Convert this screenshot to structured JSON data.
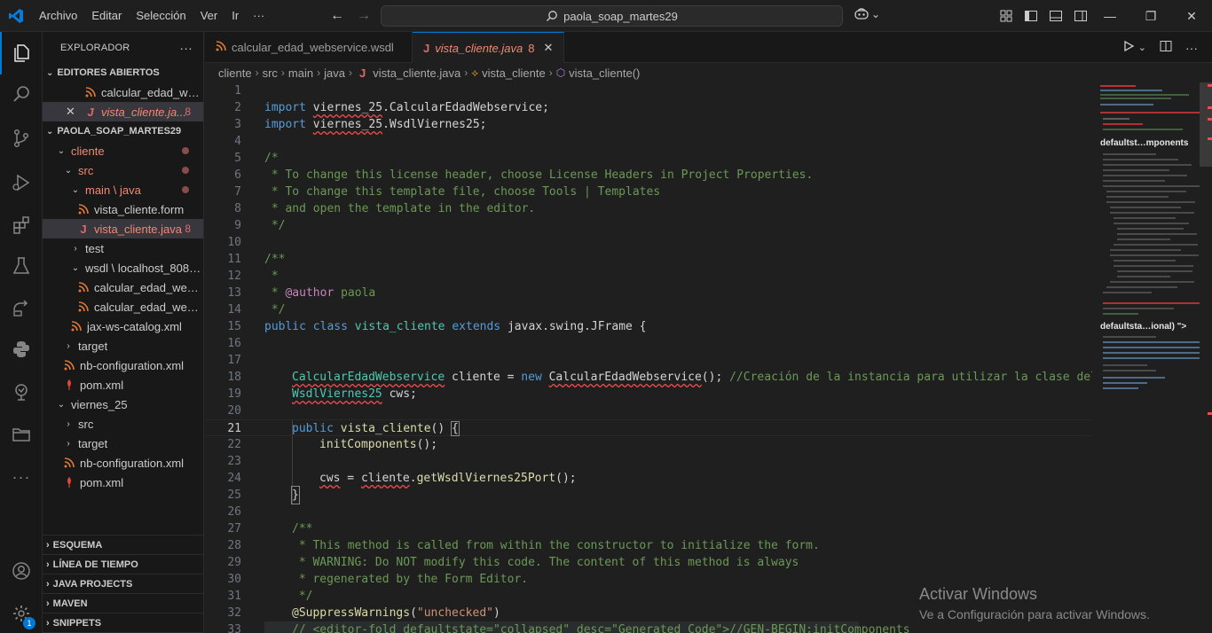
{
  "titlebar": {
    "menu": [
      "Archivo",
      "Editar",
      "Selección",
      "Ver",
      "Ir",
      "···"
    ],
    "search_text": "paola_soap_martes29"
  },
  "explorer": {
    "title": "EXPLORADOR",
    "more": "···",
    "open_editors_title": "EDITORES ABIERTOS",
    "open_editors": [
      {
        "label": "calcular_edad_web...",
        "count": ""
      },
      {
        "label": "vista_cliente.ja...",
        "count": "8"
      }
    ],
    "project_title": "PAOLA_SOAP_MARTES29",
    "tree": [
      {
        "label": "cliente",
        "count": ""
      },
      {
        "label": "src",
        "count": ""
      },
      {
        "label": "main \\ java",
        "count": ""
      },
      {
        "label": "vista_cliente.form",
        "count": ""
      },
      {
        "label": "vista_cliente.java",
        "count": "8"
      },
      {
        "label": "test",
        "count": ""
      },
      {
        "label": "wsdl \\ localhost_8080...",
        "count": ""
      },
      {
        "label": "calcular_edad_webs...",
        "count": ""
      },
      {
        "label": "calcular_edad_webs...",
        "count": ""
      },
      {
        "label": "jax-ws-catalog.xml",
        "count": ""
      },
      {
        "label": "target",
        "count": ""
      },
      {
        "label": "nb-configuration.xml",
        "count": ""
      },
      {
        "label": "pom.xml",
        "count": ""
      },
      {
        "label": "viernes_25",
        "count": ""
      },
      {
        "label": "src",
        "count": ""
      },
      {
        "label": "target",
        "count": ""
      },
      {
        "label": "nb-configuration.xml",
        "count": ""
      },
      {
        "label": "pom.xml",
        "count": ""
      }
    ],
    "bottom_sections": [
      "ESQUEMA",
      "LÍNEA DE TIEMPO",
      "JAVA PROJECTS",
      "MAVEN",
      "SNIPPETS"
    ]
  },
  "activity": {
    "badge": "1"
  },
  "tabs": [
    {
      "label": "calcular_edad_webservice.wsdl",
      "count": ""
    },
    {
      "label": "vista_cliente.java",
      "count": "8"
    }
  ],
  "breadcrumb": [
    "cliente",
    "src",
    "main",
    "java",
    "vista_cliente.java",
    "vista_cliente",
    "vista_cliente()"
  ],
  "editor": {
    "line_numbers": [
      "1",
      "2",
      "3",
      "4",
      "5",
      "6",
      "7",
      "8",
      "9",
      "10",
      "11",
      "12",
      "13",
      "14",
      "15",
      "16",
      "17",
      "18",
      "19",
      "20",
      "21",
      "22",
      "23",
      "24",
      "25",
      "26",
      "27",
      "28",
      "29",
      "30",
      "31",
      "32",
      "33"
    ],
    "current_line": "21",
    "code": {
      "l2_kw": "import",
      "l2_pkg": "viernes_25",
      "l2_rest": ".CalcularEdadWebservice;",
      "l3_kw": "import",
      "l3_pkg": "viernes_25",
      "l3_rest": ".WsdlViernes25;",
      "l5": "/*",
      "l6": " * To change this license header, choose License Headers in Project Properties.",
      "l7": " * To change this template file, choose Tools | Templates",
      "l8": " * and open the template in the editor.",
      "l9": " */",
      "l11": "/**",
      "l12": " *",
      "l13_pre": " * ",
      "l13_tag": "@author",
      "l13_rest": " paola",
      "l14": " */",
      "l15_kw1": "public",
      "l15_kw2": "class",
      "l15_name": "vista_cliente",
      "l15_kw3": "extends",
      "l15_rest": "javax.swing.JFrame {",
      "l18_type": "CalcularEdadWebservice",
      "l18_var": "cliente",
      "l18_eq": " = ",
      "l18_new": "new",
      "l18_ctor": "CalcularEdadWebservice",
      "l18_paren": "();",
      "l18_cm": " //Creación de la instancia para utilizar la clase del servicio",
      "l19_type": "WsdlViernes25",
      "l19_var": "cws;",
      "l21_kw": "public",
      "l21_name": "vista_cliente",
      "l21_paren": "() ",
      "l21_brace": "{",
      "l22_fn": "initComponents",
      "l22_rest": "();",
      "l24_var": "cws",
      "l24_eq": " = ",
      "l24_obj": "cliente",
      "l24_dot": ".",
      "l24_fn": "getWsdlViernes25Port",
      "l24_rest": "();",
      "l25": "}",
      "l27": "/**",
      "l28": " * This method is called from within the constructor to initialize the form.",
      "l29": " * WARNING: Do NOT modify this code. The content of this method is always",
      "l30": " * regenerated by the Form Editor.",
      "l31": " */",
      "l32_ann": "@SuppressWarnings",
      "l32_p1": "(",
      "l32_str": "\"unchecked\"",
      "l32_p2": ")",
      "l33": "// <editor-fold defaultstate=\"collapsed\" desc=\"Generated Code\">//GEN-BEGIN:initComponents"
    }
  },
  "minimap": {
    "label1": "defaultst…mponents",
    "label2": "defaultsta…ional) \">"
  },
  "watermark": {
    "line1": "Activar Windows",
    "line2": "Ve a Configuración para activar Windows."
  },
  "colors": {
    "accent": "#0078d4",
    "error": "#f48771",
    "keyword": "#569cd6",
    "type": "#4ec9b0",
    "comment": "#6a9955"
  }
}
